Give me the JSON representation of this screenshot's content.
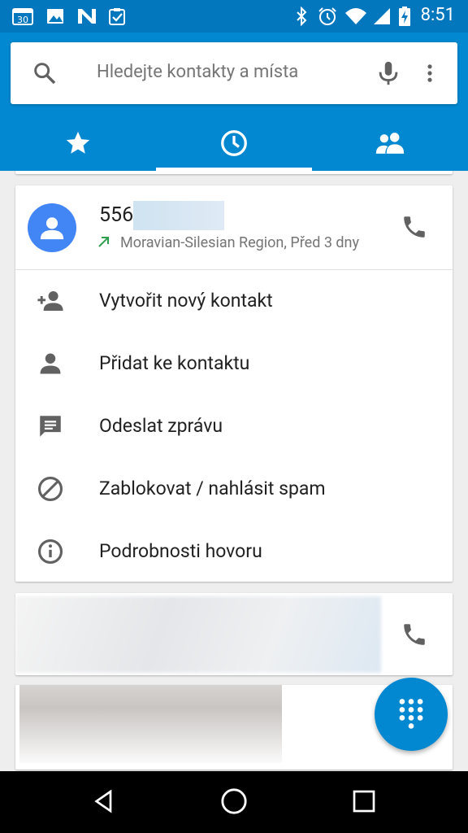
{
  "status_bar": {
    "time": "8:51",
    "left_icons": [
      "calendar-icon",
      "image-icon",
      "n-app-icon",
      "clipboard-check-icon"
    ],
    "right_icons": [
      "bluetooth-icon",
      "alarm-icon",
      "wifi-icon",
      "signal-icon",
      "battery-charging-icon"
    ]
  },
  "search": {
    "placeholder": "Hledejte kontakty a místa",
    "icons": [
      "search-icon",
      "mic-icon",
      "more-vert-icon"
    ]
  },
  "tabs": [
    {
      "name": "favorites",
      "icon": "star-icon",
      "selected": false
    },
    {
      "name": "recents",
      "icon": "clock-icon",
      "selected": true
    },
    {
      "name": "contacts",
      "icon": "people-icon",
      "selected": false
    }
  ],
  "expanded_call": {
    "number_prefix": "556",
    "location_time": "Moravian-Silesian Region, Před 3 dny",
    "direction": "outgoing",
    "actions": [
      {
        "label": "Vytvořit nový kontakt",
        "icon": "person-add-icon"
      },
      {
        "label": "Přidat ke kontaktu",
        "icon": "person-icon"
      },
      {
        "label": "Odeslat zprávu",
        "icon": "message-icon"
      },
      {
        "label": "Zablokovat / nahlásit spam",
        "icon": "block-icon"
      },
      {
        "label": "Podrobnosti hovoru",
        "icon": "info-icon"
      }
    ]
  },
  "fab": {
    "icon": "dialpad-icon"
  },
  "nav_bar": {
    "icons": [
      "back-icon",
      "home-icon",
      "recents-icon"
    ]
  },
  "colors": {
    "status_bar": "#0277bd",
    "app_bar": "#0288d1",
    "avatar": "#4285f4",
    "outgoing_arrow": "#2e9e4f",
    "icon_gray": "#616161"
  }
}
